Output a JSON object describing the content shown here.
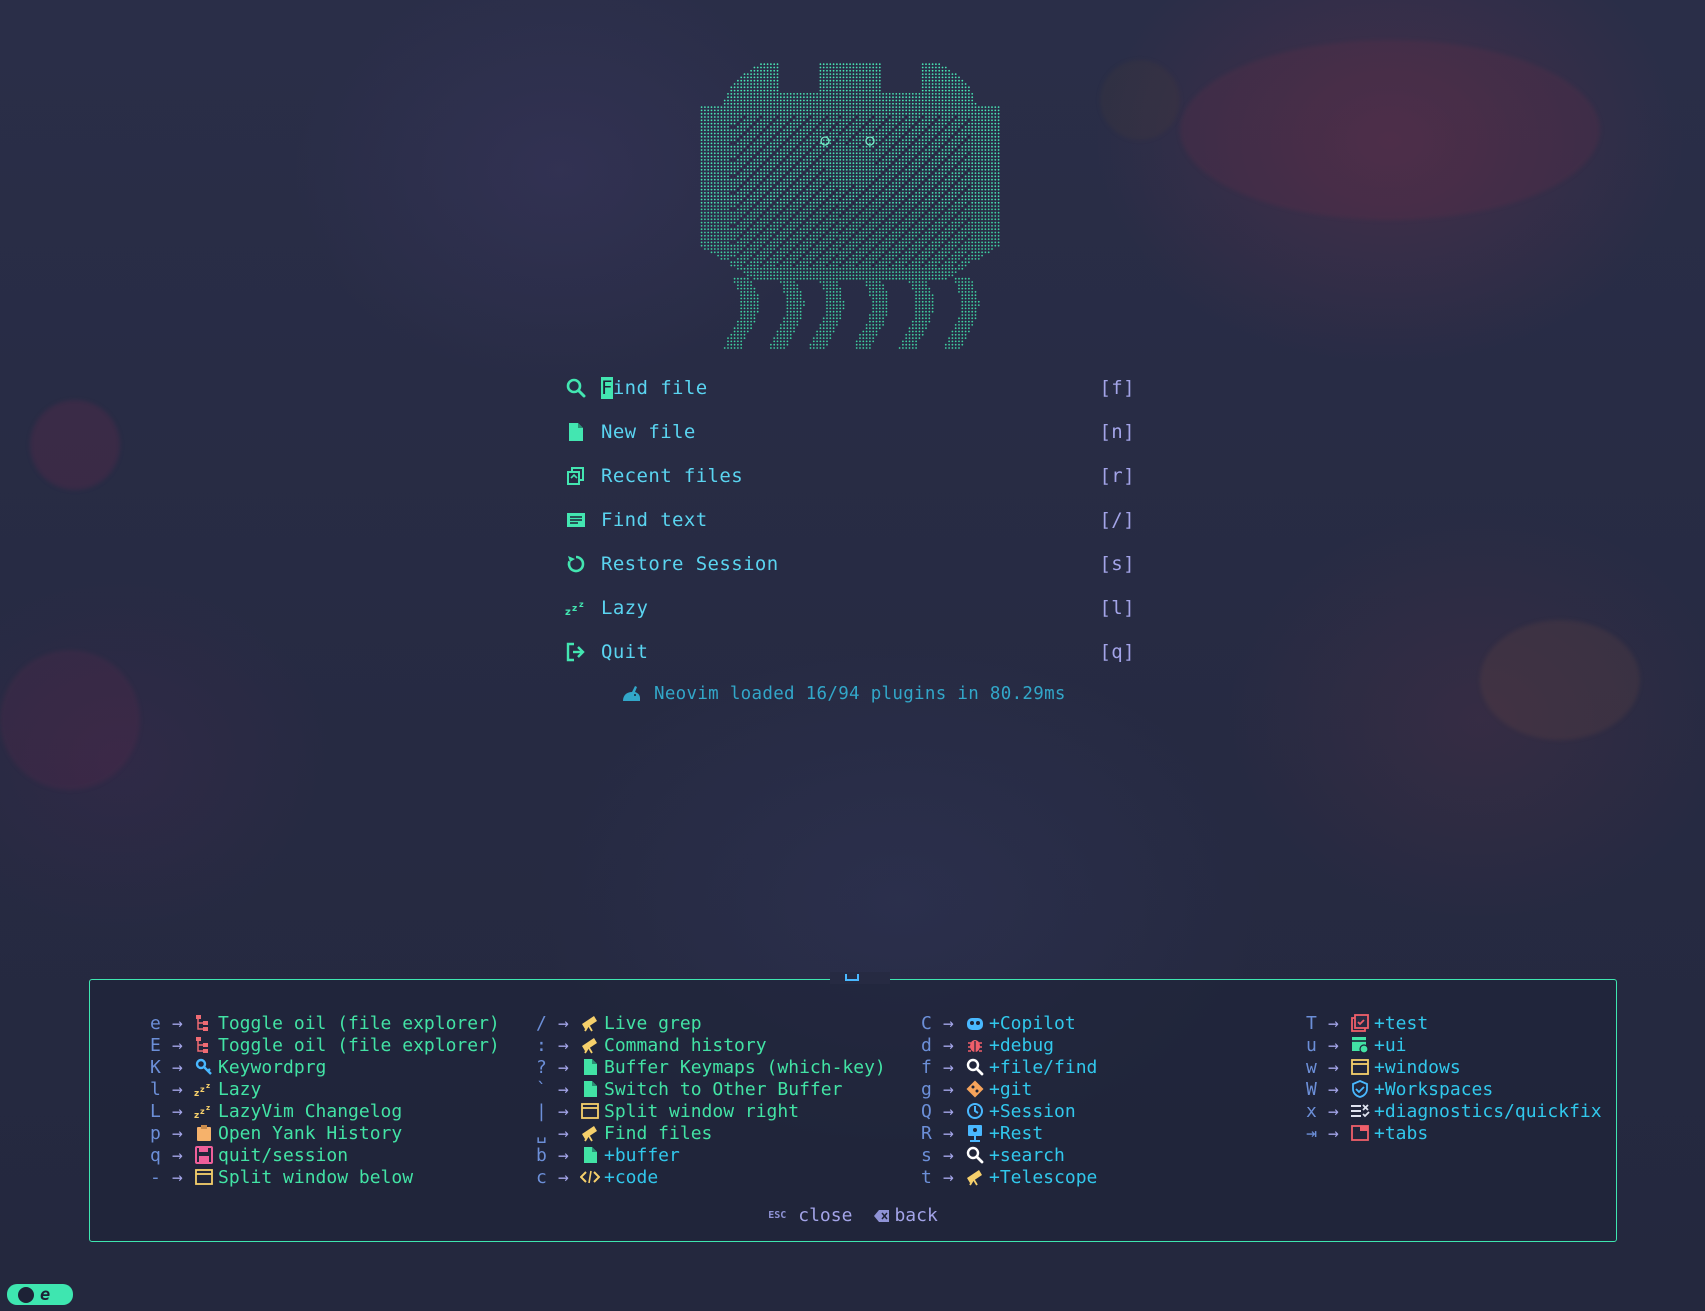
{
  "dashboard": {
    "items": [
      {
        "label": "Find file",
        "key": "[f]",
        "icon": "search-icon"
      },
      {
        "label": "New file",
        "key": "[n]",
        "icon": "file-icon"
      },
      {
        "label": "Recent files",
        "key": "[r]",
        "icon": "recent-files-icon"
      },
      {
        "label": "Find text",
        "key": "[/]",
        "icon": "text-search-icon"
      },
      {
        "label": "Restore Session",
        "key": "[s]",
        "icon": "restore-icon"
      },
      {
        "label": "Lazy",
        "key": "[l]",
        "icon": "zzz-icon"
      },
      {
        "label": "Quit",
        "key": "[q]",
        "icon": "exit-icon"
      }
    ],
    "footer": "Neovim loaded 16/94 plugins in 80.29ms"
  },
  "whichkey": {
    "columns": [
      [
        {
          "key": "e",
          "desc": "Toggle oil (file explorer)",
          "icon": "tree-icon",
          "group": false
        },
        {
          "key": "E",
          "desc": "Toggle oil (file explorer)",
          "icon": "tree-icon",
          "group": false
        },
        {
          "key": "K",
          "desc": "Keywordprg",
          "icon": "key-icon",
          "group": false
        },
        {
          "key": "l",
          "desc": "Lazy",
          "icon": "zzz-icon",
          "group": false
        },
        {
          "key": "L",
          "desc": "LazyVim Changelog",
          "icon": "zzz-icon",
          "group": false
        },
        {
          "key": "p",
          "desc": "Open Yank History",
          "icon": "clipboard-icon",
          "group": false
        },
        {
          "key": "q",
          "desc": "quit/session",
          "icon": "save-icon",
          "group": false
        },
        {
          "key": "-",
          "desc": "Split window below",
          "icon": "window-icon",
          "group": false
        }
      ],
      [
        {
          "key": "/",
          "desc": "Live grep",
          "icon": "telescope-icon",
          "group": false
        },
        {
          "key": ":",
          "desc": "Command history",
          "icon": "telescope-icon",
          "group": false
        },
        {
          "key": "?",
          "desc": "Buffer Keymaps (which-key)",
          "icon": "file-icon",
          "group": false
        },
        {
          "key": "`",
          "desc": "Switch to Other Buffer",
          "icon": "file-icon",
          "group": false
        },
        {
          "key": "|",
          "desc": "Split window right",
          "icon": "window-icon",
          "group": false
        },
        {
          "key": "␣",
          "desc": "Find files",
          "icon": "telescope-icon",
          "group": false
        },
        {
          "key": "b",
          "desc": "+buffer",
          "icon": "file-icon",
          "group": true
        },
        {
          "key": "c",
          "desc": "+code",
          "icon": "code-icon",
          "group": true
        }
      ],
      [
        {
          "key": "C",
          "desc": "+Copilot",
          "icon": "copilot-icon",
          "group": true
        },
        {
          "key": "d",
          "desc": "+debug",
          "icon": "bug-icon",
          "group": true
        },
        {
          "key": "f",
          "desc": "+file/find",
          "icon": "search-icon",
          "group": true
        },
        {
          "key": "g",
          "desc": "+git",
          "icon": "git-icon",
          "group": true
        },
        {
          "key": "Q",
          "desc": "+Session",
          "icon": "clock-icon",
          "group": true
        },
        {
          "key": "R",
          "desc": "+Rest",
          "icon": "rest-icon",
          "group": true
        },
        {
          "key": "s",
          "desc": "+search",
          "icon": "search-icon",
          "group": true
        },
        {
          "key": "t",
          "desc": "+Telescope",
          "icon": "telescope-icon",
          "group": true
        }
      ],
      [
        {
          "key": "T",
          "desc": "+test",
          "icon": "test-icon",
          "group": true
        },
        {
          "key": "u",
          "desc": "+ui",
          "icon": "ui-icon",
          "group": true
        },
        {
          "key": "w",
          "desc": "+windows",
          "icon": "window-icon",
          "group": true
        },
        {
          "key": "W",
          "desc": "+Workspaces",
          "icon": "shield-icon",
          "group": true
        },
        {
          "key": "x",
          "desc": "+diagnostics/quickfix",
          "icon": "checklist-icon",
          "group": true
        },
        {
          "key": "⇥",
          "desc": "+tabs",
          "icon": "tabs-icon",
          "group": true
        }
      ]
    ],
    "footer": {
      "esc_badge": "ESC",
      "close_label": "close",
      "back_label": "back"
    }
  },
  "statusline": {
    "mode": "e"
  },
  "colors": {
    "accent": "#3ee6b0",
    "label": "#5ad4f0",
    "key": "#a3a4e8",
    "desc": "#42e3a5",
    "group": "#31c8ec"
  }
}
